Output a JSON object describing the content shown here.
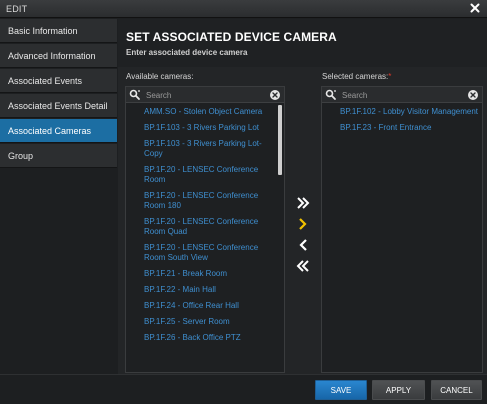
{
  "window": {
    "title": "EDIT"
  },
  "sidebar": {
    "items": [
      {
        "label": "Basic Information"
      },
      {
        "label": "Advanced Information"
      },
      {
        "label": "Associated Events"
      },
      {
        "label": "Associated Events Detail"
      },
      {
        "label": "Associated Cameras",
        "active": true
      },
      {
        "label": "Group"
      }
    ]
  },
  "main": {
    "heading": "SET ASSOCIATED DEVICE CAMERA",
    "subheading": "Enter associated device camera",
    "available": {
      "label": "Available cameras:",
      "search_placeholder": "Search",
      "items": [
        "AMM.SO - Stolen Object Camera",
        "BP.1F.103 - 3 Rivers Parking Lot",
        "BP.1F.103 - 3 Rivers Parking Lot-Copy",
        "BP.1F.20 - LENSEC Conference Room",
        "BP.1F.20 - LENSEC Conference Room 180",
        "BP.1F.20 - LENSEC Conference Room Quad",
        "BP.1F.20 - LENSEC Conference Room South View",
        "BP.1F.21 - Break Room",
        "BP.1F.22 - Main Hall",
        "BP.1F.24 - Office Rear Hall",
        "BP.1F.25 - Server Room",
        "BP.1F.26 - Back Office PTZ"
      ]
    },
    "selected": {
      "label": "Selected cameras:",
      "required_mark": "*",
      "search_placeholder": "Search",
      "items": [
        "BP.1F.102 - Lobby Visitor Management",
        "BP.1F.23 - Front Entrance"
      ]
    }
  },
  "footer": {
    "save": "SAVE",
    "apply": "APPLY",
    "cancel": "CANCEL"
  },
  "colors": {
    "accent": "#1c6ea3",
    "link": "#3f8fd0",
    "arrow_white": "#ffffff",
    "arrow_yellow": "#f2c200"
  }
}
